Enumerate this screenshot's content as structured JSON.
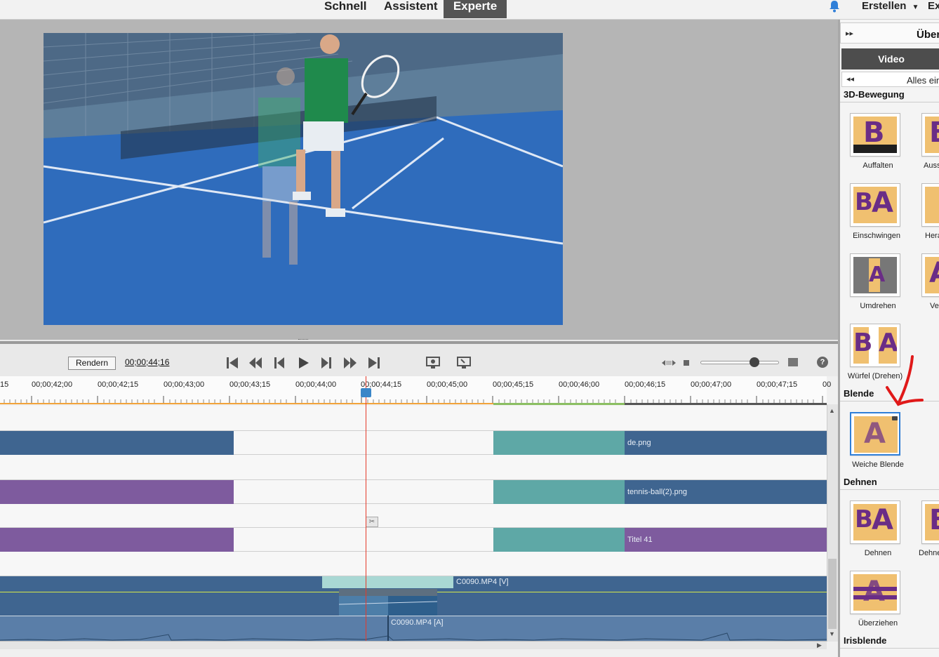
{
  "topbar": {
    "tabs": [
      {
        "label": "Schnell"
      },
      {
        "label": "Assistent"
      },
      {
        "label": "Experte",
        "active": true
      }
    ],
    "create_label": "Erstellen",
    "export_label": "Ex"
  },
  "monitor": {
    "grip": "·····"
  },
  "transport": {
    "render_label": "Rendern",
    "timecode": "00;00;44;16",
    "help_label": "?"
  },
  "timeline": {
    "ruler_labels": [
      "15",
      "00;00;42;00",
      "00;00;42;15",
      "00;00;43;00",
      "00;00;43;15",
      "00;00;44;00",
      "00;00;44;15",
      "00;00;45;00",
      "00;00;45;15",
      "00;00;46;00",
      "00;00;46;15",
      "00;00;47;00",
      "00;00;47;15",
      "00"
    ],
    "clips": {
      "png_clip": "de.png",
      "ball_clip": "tennis-ball(2).png",
      "title_clip": "Titel 41",
      "video_clip": "C0090.MP4 [V]",
      "audio_clip": "C0090.MP4 [A]"
    },
    "colors": {
      "blue": "#3f6590",
      "purple": "#7e5b9e",
      "teal": "#5ea8a6",
      "playhead": "#e53a2a"
    }
  },
  "panel": {
    "title": "Über",
    "video_tab": "Video",
    "filter_label": "Alles ein",
    "categories": {
      "motion3d": "3D-Bewegung",
      "dissolve": "Blende",
      "stretch": "Dehnen",
      "iris": "Irisblende"
    },
    "items": {
      "auffalten": "Auffalten",
      "auss": "Auss",
      "einschwingen": "Einschwingen",
      "hera": "Hera",
      "umdrehen": "Umdrehen",
      "ve": "Ve",
      "wuerfel": "Würfel (Drehen)",
      "weiche_blende": "Weiche Blende",
      "dehnen": "Dehnen",
      "dehne": "Dehne",
      "ueberziehen": "Überziehen"
    }
  }
}
